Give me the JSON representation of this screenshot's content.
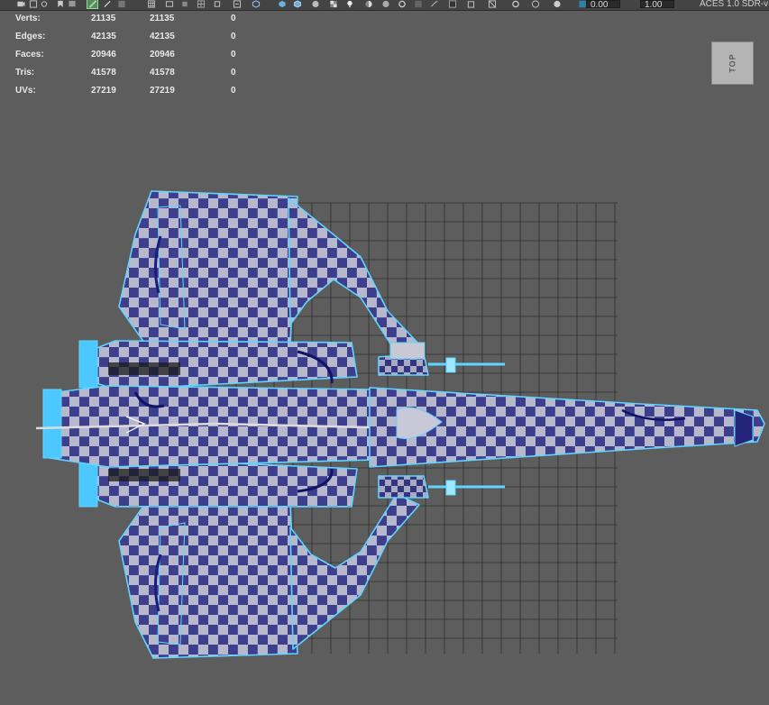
{
  "toolbar": {
    "exposure_value": "0.00",
    "gamma_value": "1.00",
    "colorspace_label": "ACES 1.0 SDR-v",
    "icons": [
      "camera-icon",
      "film-icon",
      "lock-camera-icon",
      "bookmark-icon",
      "image-plane-icon",
      "sculpt-brush-icon",
      "grease-pencil-icon",
      "square-icon",
      "grid-icon",
      "film-gate-icon",
      "resolution-gate-icon",
      "field-chart-icon",
      "safe-action-icon",
      "safe-title-icon",
      "wireframe-cube-icon",
      "smooth-shade-icon",
      "shaded-wireframe-icon",
      "default-material-icon",
      "textured-icon",
      "use-lights-icon",
      "shadows-icon",
      "screen-space-ao-icon",
      "motion-blur-icon",
      "anti-aliasing-icon",
      "depth-of-field-icon",
      "isolate-select-icon",
      "xray-icon",
      "xray-active-icon",
      "xray-joints-icon",
      "exposure-icon",
      "gamma-icon",
      "color-management-icon"
    ]
  },
  "hud": {
    "rows": [
      {
        "label": "Verts:",
        "col1": "21135",
        "col2": "21135",
        "col3": "0"
      },
      {
        "label": "Edges:",
        "col1": "42135",
        "col2": "42135",
        "col3": "0"
      },
      {
        "label": "Faces:",
        "col1": "20946",
        "col2": "20946",
        "col3": "0"
      },
      {
        "label": "Tris:",
        "col1": "41578",
        "col2": "41578",
        "col3": "0"
      },
      {
        "label": "UVs:",
        "col1": "27219",
        "col2": "27219",
        "col3": "0"
      }
    ]
  },
  "viewcube": {
    "label": "TOP"
  },
  "colors": {
    "background": "#5d5d5d",
    "grid_line": "#2b2b2b",
    "wire": "#59d6ff",
    "checker_light": "#b8b8cc",
    "checker_dark": "#3e3f8c"
  }
}
